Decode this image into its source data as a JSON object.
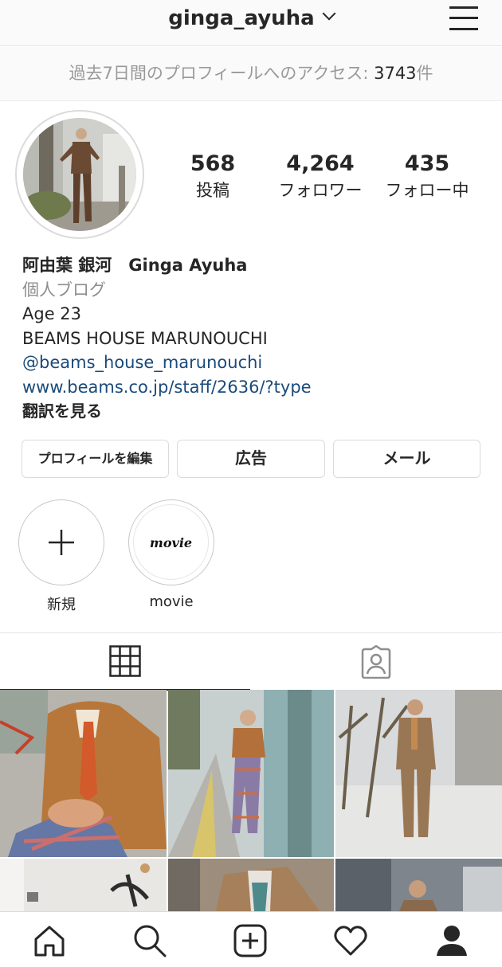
{
  "header": {
    "username": "ginga_ayuha",
    "chevron_icon": "chevron-down-icon",
    "menu_icon": "hamburger-menu-icon"
  },
  "access_banner": {
    "label": "過去7日間のプロフィールへのアクセス: ",
    "count": "3743",
    "suffix": "件"
  },
  "stats": {
    "posts": {
      "value": "568",
      "label": "投稿"
    },
    "followers": {
      "value": "4,264",
      "label": "フォロワー"
    },
    "following": {
      "value": "435",
      "label": "フォロー中"
    }
  },
  "bio": {
    "name": "阿由葉 銀河　Ginga Ayuha",
    "category": "個人ブログ",
    "line1": "Age 23",
    "line2": "BEAMS HOUSE MARUNOUCHI",
    "mention": "@beams_house_marunouchi",
    "website": "www.beams.co.jp/staff/2636/?type",
    "translate": "翻訳を見る"
  },
  "buttons": {
    "edit_profile": "プロフィールを編集",
    "ads": "広告",
    "email": "メール"
  },
  "highlights": [
    {
      "label": "新規",
      "icon": "plus-icon"
    },
    {
      "label": "movie",
      "cover_text": "movie"
    }
  ],
  "tabs": [
    {
      "icon": "grid-icon",
      "active": true
    },
    {
      "icon": "tagged-person-icon",
      "active": false
    }
  ],
  "bottom_nav": [
    {
      "icon": "home-icon"
    },
    {
      "icon": "search-icon"
    },
    {
      "icon": "new-post-icon"
    },
    {
      "icon": "heart-icon"
    },
    {
      "icon": "profile-icon"
    }
  ],
  "colors": {
    "text": "#262626",
    "muted": "#8e8e8e",
    "link": "#1a4a7a",
    "border": "#dbdbdb"
  }
}
